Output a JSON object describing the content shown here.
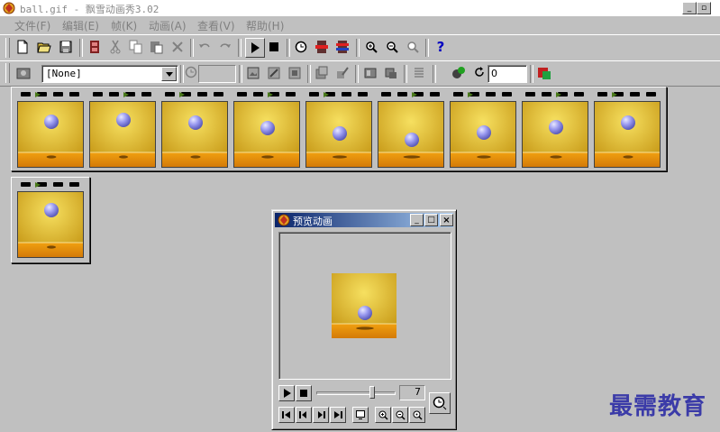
{
  "window": {
    "title": "ball.gif - 飘雪动画秀3.02"
  },
  "menu": [
    "文件(F)",
    "编辑(E)",
    "帧(K)",
    "动画(A)",
    "查看(V)",
    "帮助(H)"
  ],
  "toolbar1": {
    "icons": [
      "new-file-icon",
      "open-folder-icon",
      "save-icon",
      "filmstrip-icon",
      "cut-icon",
      "copy-icon",
      "paste-icon",
      "delete-icon",
      "undo-icon",
      "redo-icon",
      "play-icon",
      "stop-icon",
      "timer-icon",
      "frame-insert-icon",
      "frame-swap-icon",
      "zoom-in-icon",
      "zoom-out-icon",
      "zoom-fit-icon",
      "help-icon"
    ]
  },
  "toolbar2": {
    "transparent_dropdown": "[None]",
    "delay_value": "",
    "loop_value": "0"
  },
  "frames": {
    "count": 10
  },
  "preview": {
    "title": "预览动画",
    "speed_value": "7",
    "speed_level": 0.72
  },
  "watermark": "最需教育",
  "colors": {
    "title_active": "#0a246a",
    "frame_yellow": "#e8c030",
    "frame_orange": "#e8900a",
    "ball": "#8c8ce8"
  }
}
